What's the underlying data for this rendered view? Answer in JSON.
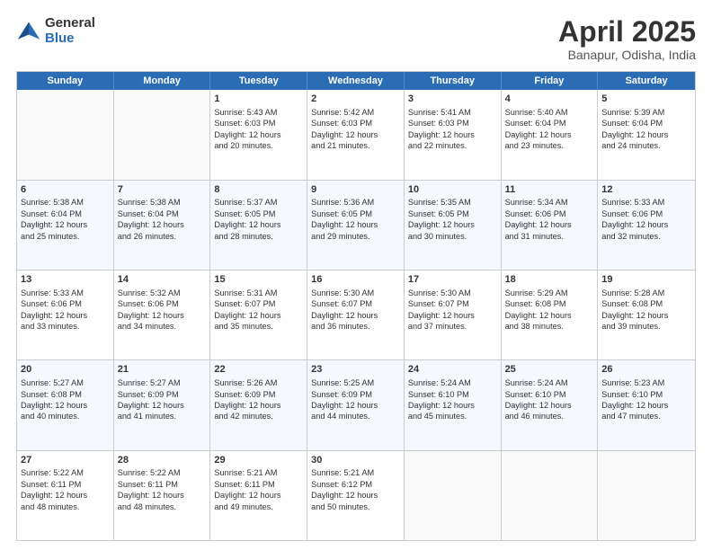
{
  "header": {
    "logo": {
      "general": "General",
      "blue": "Blue"
    },
    "title": "April 2025",
    "location": "Banapur, Odisha, India"
  },
  "calendar": {
    "days": [
      "Sunday",
      "Monday",
      "Tuesday",
      "Wednesday",
      "Thursday",
      "Friday",
      "Saturday"
    ],
    "rows": [
      [
        {
          "day": "",
          "empty": true
        },
        {
          "day": "",
          "empty": true
        },
        {
          "day": "1",
          "line1": "Sunrise: 5:43 AM",
          "line2": "Sunset: 6:03 PM",
          "line3": "Daylight: 12 hours",
          "line4": "and 20 minutes."
        },
        {
          "day": "2",
          "line1": "Sunrise: 5:42 AM",
          "line2": "Sunset: 6:03 PM",
          "line3": "Daylight: 12 hours",
          "line4": "and 21 minutes."
        },
        {
          "day": "3",
          "line1": "Sunrise: 5:41 AM",
          "line2": "Sunset: 6:03 PM",
          "line3": "Daylight: 12 hours",
          "line4": "and 22 minutes."
        },
        {
          "day": "4",
          "line1": "Sunrise: 5:40 AM",
          "line2": "Sunset: 6:04 PM",
          "line3": "Daylight: 12 hours",
          "line4": "and 23 minutes."
        },
        {
          "day": "5",
          "line1": "Sunrise: 5:39 AM",
          "line2": "Sunset: 6:04 PM",
          "line3": "Daylight: 12 hours",
          "line4": "and 24 minutes."
        }
      ],
      [
        {
          "day": "6",
          "line1": "Sunrise: 5:38 AM",
          "line2": "Sunset: 6:04 PM",
          "line3": "Daylight: 12 hours",
          "line4": "and 25 minutes."
        },
        {
          "day": "7",
          "line1": "Sunrise: 5:38 AM",
          "line2": "Sunset: 6:04 PM",
          "line3": "Daylight: 12 hours",
          "line4": "and 26 minutes."
        },
        {
          "day": "8",
          "line1": "Sunrise: 5:37 AM",
          "line2": "Sunset: 6:05 PM",
          "line3": "Daylight: 12 hours",
          "line4": "and 28 minutes."
        },
        {
          "day": "9",
          "line1": "Sunrise: 5:36 AM",
          "line2": "Sunset: 6:05 PM",
          "line3": "Daylight: 12 hours",
          "line4": "and 29 minutes."
        },
        {
          "day": "10",
          "line1": "Sunrise: 5:35 AM",
          "line2": "Sunset: 6:05 PM",
          "line3": "Daylight: 12 hours",
          "line4": "and 30 minutes."
        },
        {
          "day": "11",
          "line1": "Sunrise: 5:34 AM",
          "line2": "Sunset: 6:06 PM",
          "line3": "Daylight: 12 hours",
          "line4": "and 31 minutes."
        },
        {
          "day": "12",
          "line1": "Sunrise: 5:33 AM",
          "line2": "Sunset: 6:06 PM",
          "line3": "Daylight: 12 hours",
          "line4": "and 32 minutes."
        }
      ],
      [
        {
          "day": "13",
          "line1": "Sunrise: 5:33 AM",
          "line2": "Sunset: 6:06 PM",
          "line3": "Daylight: 12 hours",
          "line4": "and 33 minutes."
        },
        {
          "day": "14",
          "line1": "Sunrise: 5:32 AM",
          "line2": "Sunset: 6:06 PM",
          "line3": "Daylight: 12 hours",
          "line4": "and 34 minutes."
        },
        {
          "day": "15",
          "line1": "Sunrise: 5:31 AM",
          "line2": "Sunset: 6:07 PM",
          "line3": "Daylight: 12 hours",
          "line4": "and 35 minutes."
        },
        {
          "day": "16",
          "line1": "Sunrise: 5:30 AM",
          "line2": "Sunset: 6:07 PM",
          "line3": "Daylight: 12 hours",
          "line4": "and 36 minutes."
        },
        {
          "day": "17",
          "line1": "Sunrise: 5:30 AM",
          "line2": "Sunset: 6:07 PM",
          "line3": "Daylight: 12 hours",
          "line4": "and 37 minutes."
        },
        {
          "day": "18",
          "line1": "Sunrise: 5:29 AM",
          "line2": "Sunset: 6:08 PM",
          "line3": "Daylight: 12 hours",
          "line4": "and 38 minutes."
        },
        {
          "day": "19",
          "line1": "Sunrise: 5:28 AM",
          "line2": "Sunset: 6:08 PM",
          "line3": "Daylight: 12 hours",
          "line4": "and 39 minutes."
        }
      ],
      [
        {
          "day": "20",
          "line1": "Sunrise: 5:27 AM",
          "line2": "Sunset: 6:08 PM",
          "line3": "Daylight: 12 hours",
          "line4": "and 40 minutes."
        },
        {
          "day": "21",
          "line1": "Sunrise: 5:27 AM",
          "line2": "Sunset: 6:09 PM",
          "line3": "Daylight: 12 hours",
          "line4": "and 41 minutes."
        },
        {
          "day": "22",
          "line1": "Sunrise: 5:26 AM",
          "line2": "Sunset: 6:09 PM",
          "line3": "Daylight: 12 hours",
          "line4": "and 42 minutes."
        },
        {
          "day": "23",
          "line1": "Sunrise: 5:25 AM",
          "line2": "Sunset: 6:09 PM",
          "line3": "Daylight: 12 hours",
          "line4": "and 44 minutes."
        },
        {
          "day": "24",
          "line1": "Sunrise: 5:24 AM",
          "line2": "Sunset: 6:10 PM",
          "line3": "Daylight: 12 hours",
          "line4": "and 45 minutes."
        },
        {
          "day": "25",
          "line1": "Sunrise: 5:24 AM",
          "line2": "Sunset: 6:10 PM",
          "line3": "Daylight: 12 hours",
          "line4": "and 46 minutes."
        },
        {
          "day": "26",
          "line1": "Sunrise: 5:23 AM",
          "line2": "Sunset: 6:10 PM",
          "line3": "Daylight: 12 hours",
          "line4": "and 47 minutes."
        }
      ],
      [
        {
          "day": "27",
          "line1": "Sunrise: 5:22 AM",
          "line2": "Sunset: 6:11 PM",
          "line3": "Daylight: 12 hours",
          "line4": "and 48 minutes."
        },
        {
          "day": "28",
          "line1": "Sunrise: 5:22 AM",
          "line2": "Sunset: 6:11 PM",
          "line3": "Daylight: 12 hours",
          "line4": "and 48 minutes."
        },
        {
          "day": "29",
          "line1": "Sunrise: 5:21 AM",
          "line2": "Sunset: 6:11 PM",
          "line3": "Daylight: 12 hours",
          "line4": "and 49 minutes."
        },
        {
          "day": "30",
          "line1": "Sunrise: 5:21 AM",
          "line2": "Sunset: 6:12 PM",
          "line3": "Daylight: 12 hours",
          "line4": "and 50 minutes."
        },
        {
          "day": "",
          "empty": true
        },
        {
          "day": "",
          "empty": true
        },
        {
          "day": "",
          "empty": true
        }
      ]
    ]
  }
}
